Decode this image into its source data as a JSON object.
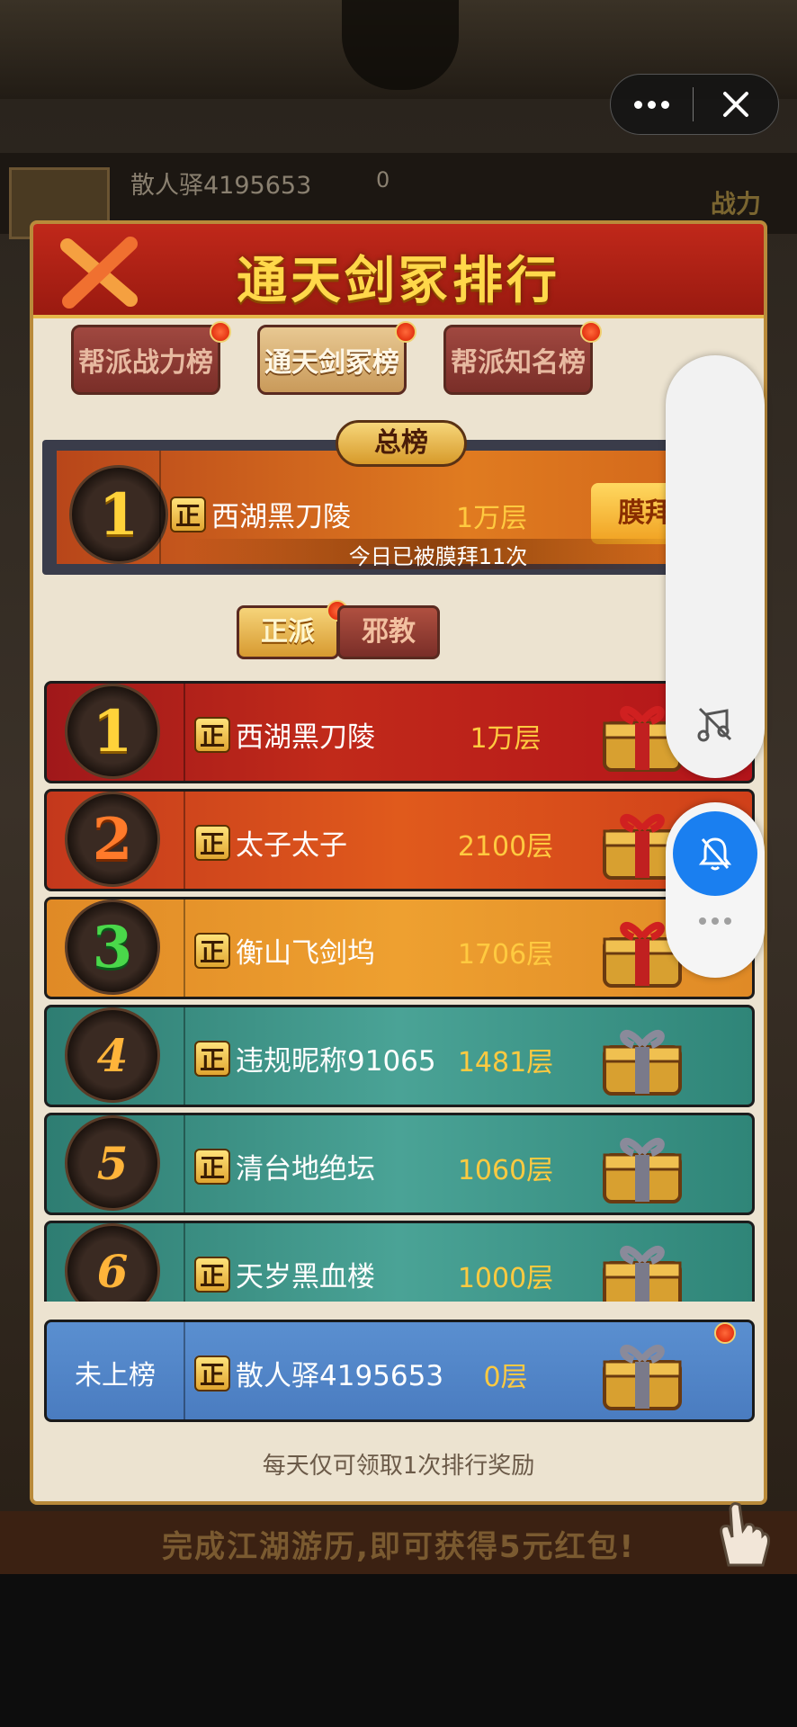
{
  "background": {
    "player_name": "散人驿4195653",
    "player_value": "0",
    "power_label": "战力",
    "banner_text": "完成江湖游历,即可获得5元红包!"
  },
  "panel": {
    "title": "通天剑冢排行",
    "tabs": [
      {
        "label": "帮派战力榜",
        "active": false
      },
      {
        "label": "通天剑冢榜",
        "active": true
      },
      {
        "label": "帮派知名榜",
        "active": false
      }
    ],
    "overall": {
      "label": "总榜",
      "rank": "1",
      "faction": "正",
      "name": "西湖黑刀陵",
      "floor": "1万层",
      "worship_button": "膜拜",
      "worship_count": "今日已被膜拜11次"
    },
    "faction_tabs": [
      {
        "label": "正派",
        "active": true
      },
      {
        "label": "邪教",
        "active": false
      }
    ],
    "rows": [
      {
        "rank": "1",
        "faction": "正",
        "name": "西湖黑刀陵",
        "floor": "1万层"
      },
      {
        "rank": "2",
        "faction": "正",
        "name": "太子太子",
        "floor": "2100层"
      },
      {
        "rank": "3",
        "faction": "正",
        "name": "衡山飞剑坞",
        "floor": "1706层"
      },
      {
        "rank": "4",
        "faction": "正",
        "name": "违规昵称91065",
        "floor": "1481层"
      },
      {
        "rank": "5",
        "faction": "正",
        "name": "清台地绝坛",
        "floor": "1060层"
      },
      {
        "rank": "6",
        "faction": "正",
        "name": "天岁黑血楼",
        "floor": "1000层"
      }
    ],
    "mine": {
      "status": "未上榜",
      "faction": "正",
      "name": "散人驿4195653",
      "floor": "0层"
    },
    "footer": "每天仅可领取1次排行奖励"
  },
  "colors": {
    "header_red": "#b0201a",
    "gold_text": "#ffd84a",
    "floor_text": "#ffca40",
    "teal_row": "#3f968a",
    "mine_row": "#5a8fd0",
    "wechat_blue": "#1a7ff0"
  },
  "icons": [
    "more-dots-icon",
    "close-icon",
    "close-x-icon",
    "chest-icon",
    "music-off-icon",
    "bell-off-icon",
    "hand-pointer-icon"
  ]
}
